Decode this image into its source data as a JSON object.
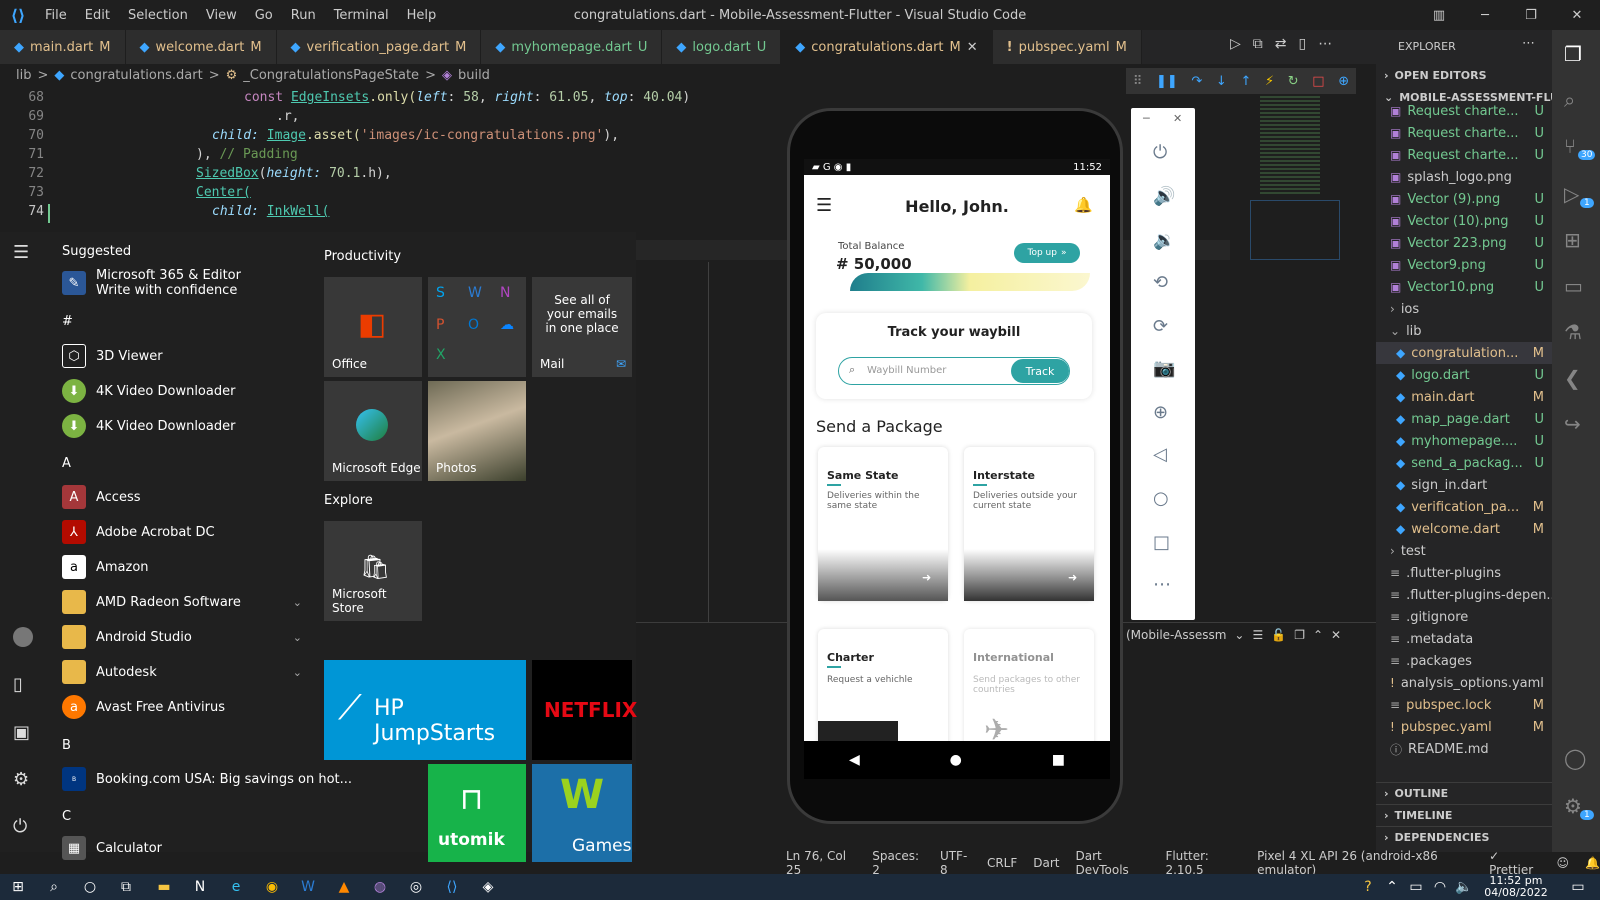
{
  "window": {
    "title": "congratulations.dart - Mobile-Assessment-Flutter - Visual Studio Code",
    "menu": [
      "File",
      "Edit",
      "Selection",
      "View",
      "Go",
      "Run",
      "Terminal",
      "Help"
    ]
  },
  "tabs": [
    {
      "label": "main.dart",
      "status": "M"
    },
    {
      "label": "welcome.dart",
      "status": "M"
    },
    {
      "label": "verification_page.dart",
      "status": "M"
    },
    {
      "label": "myhomepage.dart",
      "status": "U"
    },
    {
      "label": "logo.dart",
      "status": "U"
    },
    {
      "label": "congratulations.dart",
      "status": "M"
    },
    {
      "label": "pubspec.yaml",
      "status": "M"
    }
  ],
  "breadcrumb": [
    "lib",
    ">",
    "congratulations.dart",
    ">",
    "_CongratulationsPageState",
    ">",
    "build"
  ],
  "editor": {
    "lines": [
      "68",
      "69",
      "70",
      "71",
      "72",
      "73",
      "74"
    ],
    "code": {
      "l68_const": "const",
      "l68_cls": "EdgeInsets",
      "l68_only": ".only(",
      "l68_left": "left",
      "l68_v1": "58",
      "l68_right": "right",
      "l68_v2": "61.05",
      "l68_top": "top",
      "l68_v3": "40.04",
      "l68_end": ")",
      "l69": ".r,",
      "l70_child": "child:",
      "l70_img": "Image",
      "l70_asset": ".asset(",
      "l70_str": "'images/ic-congratulations.png'",
      "l70_end": "),",
      "l71_a": "),",
      "l71_c": "// Padding",
      "l72_cls": "SizedBox",
      "l72_h": "height:",
      "l72_v": "70.1",
      "l72_end": ".h),",
      "l73": "Center(",
      "l74_child": "child:",
      "l74_cls": "InkWell("
    }
  },
  "start_menu": {
    "suggested_label": "Suggested",
    "suggested": {
      "name": "Microsoft 365 & Editor",
      "sub": "Write with confidence"
    },
    "hash": "#",
    "apps_hash": [
      "3D Viewer",
      "4K Video Downloader",
      "4K Video Downloader"
    ],
    "letter_a": "A",
    "apps_a": [
      "Access",
      "Adobe Acrobat DC",
      "Amazon",
      "AMD Radeon Software",
      "Android Studio",
      "Autodesk",
      "Avast Free Antivirus"
    ],
    "letter_b": "B",
    "apps_b": [
      "Booking.com USA: Big savings on hot..."
    ],
    "letter_c": "C",
    "apps_c": [
      "Calculator"
    ],
    "productivity": "Productivity",
    "explore": "Explore",
    "tiles": {
      "office": "Office",
      "mail_text": "See all of your emails in one place",
      "mail": "Mail",
      "edge": "Microsoft Edge",
      "photos": "Photos",
      "store": "Microsoft Store",
      "hp": "HP JumpStarts",
      "netflix": "NETFLIX",
      "utomik": "utomik",
      "games": "Games"
    }
  },
  "phone": {
    "time": "11:52",
    "greeting": "Hello, John.",
    "balance_label": "Total Balance",
    "balance": "# 50,000",
    "topup": "Top up",
    "track_title": "Track your waybill",
    "track_placeholder": "Waybill Number",
    "track_button": "Track",
    "send_title": "Send a Package",
    "cards": [
      {
        "title": "Same State",
        "desc": "Deliveries within the same state"
      },
      {
        "title": "Interstate",
        "desc": "Deliveries outside your current state"
      },
      {
        "title": "Charter",
        "desc": "Request a vehichle"
      },
      {
        "title": "International",
        "desc": "Send packages to other countries"
      }
    ]
  },
  "panel": {
    "dropdown": "(Mobile-Assessm"
  },
  "explorer": {
    "title": "EXPLORER",
    "open_editors": "OPEN EDITORS",
    "project": "MOBILE-ASSESSMENT-FLU...",
    "items": [
      {
        "label": "Request charte...",
        "status": "U",
        "kind": "img"
      },
      {
        "label": "Request charte...",
        "status": "U",
        "kind": "img"
      },
      {
        "label": "Request charte...",
        "status": "U",
        "kind": "img"
      },
      {
        "label": "splash_logo.png",
        "status": "",
        "kind": "img"
      },
      {
        "label": "Vector (9).png",
        "status": "U",
        "kind": "img"
      },
      {
        "label": "Vector (10).png",
        "status": "U",
        "kind": "img"
      },
      {
        "label": "Vector 223.png",
        "status": "U",
        "kind": "img"
      },
      {
        "label": "Vector9.png",
        "status": "U",
        "kind": "img"
      },
      {
        "label": "Vector10.png",
        "status": "U",
        "kind": "img"
      },
      {
        "label": "ios",
        "status": "",
        "kind": "folder"
      },
      {
        "label": "lib",
        "status": "",
        "kind": "folder-open"
      },
      {
        "label": "congratulation...",
        "status": "M",
        "kind": "dart"
      },
      {
        "label": "logo.dart",
        "status": "U",
        "kind": "dart"
      },
      {
        "label": "main.dart",
        "status": "M",
        "kind": "dart"
      },
      {
        "label": "map_page.dart",
        "status": "U",
        "kind": "dart"
      },
      {
        "label": "myhomepage....",
        "status": "U",
        "kind": "dart"
      },
      {
        "label": "send_a_packag...",
        "status": "U",
        "kind": "dart"
      },
      {
        "label": "sign_in.dart",
        "status": "",
        "kind": "dart"
      },
      {
        "label": "verification_pa...",
        "status": "M",
        "kind": "dart"
      },
      {
        "label": "welcome.dart",
        "status": "M",
        "kind": "dart"
      },
      {
        "label": "test",
        "status": "",
        "kind": "folder"
      },
      {
        "label": ".flutter-plugins",
        "status": "",
        "kind": "file"
      },
      {
        "label": ".flutter-plugins-depen...",
        "status": "",
        "kind": "file"
      },
      {
        "label": ".gitignore",
        "status": "",
        "kind": "file"
      },
      {
        "label": ".metadata",
        "status": "",
        "kind": "file"
      },
      {
        "label": ".packages",
        "status": "",
        "kind": "file"
      },
      {
        "label": "analysis_options.yaml",
        "status": "",
        "kind": "yaml"
      },
      {
        "label": "pubspec.lock",
        "status": "M",
        "kind": "file"
      },
      {
        "label": "pubspec.yaml",
        "status": "M",
        "kind": "yaml"
      },
      {
        "label": "README.md",
        "status": "",
        "kind": "info"
      }
    ],
    "outline": "OUTLINE",
    "timeline": "TIMELINE",
    "dependencies": "DEPENDENCIES"
  },
  "activity_badges": {
    "scm": "30",
    "run": "1",
    "settings": "1"
  },
  "statusbar": [
    "Ln 76, Col 25",
    "Spaces: 2",
    "UTF-8",
    "CRLF",
    "Dart",
    "Dart DevTools",
    "Flutter: 2.10.5",
    "Pixel 4 XL API 26 (android-x86 emulator)",
    "Prettier"
  ],
  "taskbar": {
    "time": "11:52 pm",
    "date": "04/08/2022"
  },
  "colors": {
    "accent": "#3ea6ff",
    "modified": "#e2c08d",
    "untracked": "#73c991",
    "teal": "#2ea3a3",
    "hp": "#0096d6",
    "netflix": "#e50914",
    "utomik": "#17b34a"
  }
}
